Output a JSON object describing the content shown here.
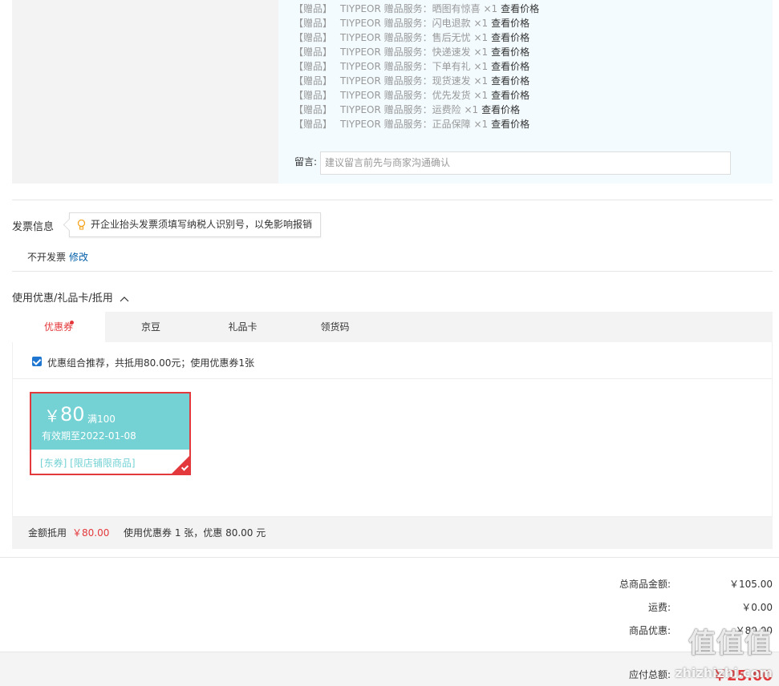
{
  "gifts": [
    {
      "tag": "【赠品】",
      "name": "TIYPEOR 赠品服务：晒图有惊喜",
      "qty": "×1",
      "link": "查看价格"
    },
    {
      "tag": "【赠品】",
      "name": "TIYPEOR 赠品服务：闪电退款",
      "qty": "×1",
      "link": "查看价格"
    },
    {
      "tag": "【赠品】",
      "name": "TIYPEOR 赠品服务：售后无忧",
      "qty": "×1",
      "link": "查看价格"
    },
    {
      "tag": "【赠品】",
      "name": "TIYPEOR 赠品服务：快递速发",
      "qty": "×1",
      "link": "查看价格"
    },
    {
      "tag": "【赠品】",
      "name": "TIYPEOR 赠品服务：下单有礼",
      "qty": "×1",
      "link": "查看价格"
    },
    {
      "tag": "【赠品】",
      "name": "TIYPEOR 赠品服务：现货速发",
      "qty": "×1",
      "link": "查看价格"
    },
    {
      "tag": "【赠品】",
      "name": "TIYPEOR 赠品服务：优先发货",
      "qty": "×1",
      "link": "查看价格"
    },
    {
      "tag": "【赠品】",
      "name": "TIYPEOR 赠品服务：运费险",
      "qty": "×1",
      "link": "查看价格"
    },
    {
      "tag": "【赠品】",
      "name": "TIYPEOR 赠品服务：正品保障",
      "qty": "×1",
      "link": "查看价格"
    }
  ],
  "message": {
    "label": "留言:",
    "placeholder": "建议留言前先与商家沟通确认"
  },
  "invoice": {
    "title": "发票信息",
    "tip": "开企业抬头发票须填写纳税人识别号，以免影响报销",
    "status": "不开发票",
    "edit": "修改"
  },
  "discount": {
    "title": "使用优惠/礼品卡/抵用",
    "tabs": [
      "优惠券",
      "京豆",
      "礼品卡",
      "领货码"
    ],
    "active_tab": 0,
    "combo_text": "优惠组合推荐，共抵用80.00元；使用优惠券1张",
    "combo_checked": true,
    "coupon": {
      "yen": "￥",
      "amount": "80",
      "condition": "满100",
      "valid": "有效期至2022-01-08",
      "tags": "[东券] [限店铺限商品]"
    },
    "summary_label": "金额抵用",
    "summary_amount": "￥80.00",
    "summary_text": "使用优惠券 1 张，优惠 80.00 元"
  },
  "totals": {
    "items_label": "总商品金额:",
    "items_value": "￥105.00",
    "shipping_label": "运费:",
    "shipping_value": "￥0.00",
    "promo_label": "商品优惠:",
    "promo_value": "-￥80.00",
    "payable_label": "应付总额:",
    "payable_value": "￥25.00"
  },
  "watermark": {
    "logo": "值值值",
    "site": "zhizhizhi.com"
  },
  "colors": {
    "accent": "#e4393c",
    "coupon": "#74d2d4",
    "link": "#005ea7"
  }
}
